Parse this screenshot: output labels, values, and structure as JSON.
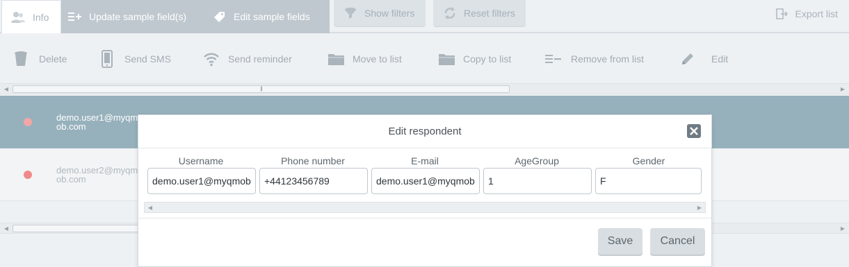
{
  "tabs": {
    "info": "Info",
    "update": "Update sample field(s)",
    "edit": "Edit sample fields",
    "show_filters": "Show filters",
    "reset_filters": "Reset filters",
    "export": "Export list"
  },
  "toolbar": {
    "delete": "Delete",
    "send_sms": "Send SMS",
    "send_reminder": "Send reminder",
    "move_to_list": "Move to list",
    "copy_to_list": "Copy to list",
    "remove_from_list": "Remove from list",
    "edit": "Edit"
  },
  "rows": [
    {
      "email": "demo.user1@myqmob.com",
      "status_color": "#f3a6a6"
    },
    {
      "email": "demo.user2@myqmob.com",
      "status_color": "#f08a8a"
    }
  ],
  "modal": {
    "title": "Edit respondent",
    "labels": {
      "username": "Username",
      "phone": "Phone number",
      "email": "E-mail",
      "agegroup": "AgeGroup",
      "gender": "Gender"
    },
    "values": {
      "username": "demo.user1@myqmob.com",
      "phone": "+44123456789",
      "email": "demo.user1@myqmob.com",
      "agegroup": "1",
      "gender": "F"
    },
    "save": "Save",
    "cancel": "Cancel"
  },
  "colors": {
    "selected_row": "#97b1bc",
    "tab_group": "#bfc8cf",
    "status_dot": "#f08a8a"
  }
}
